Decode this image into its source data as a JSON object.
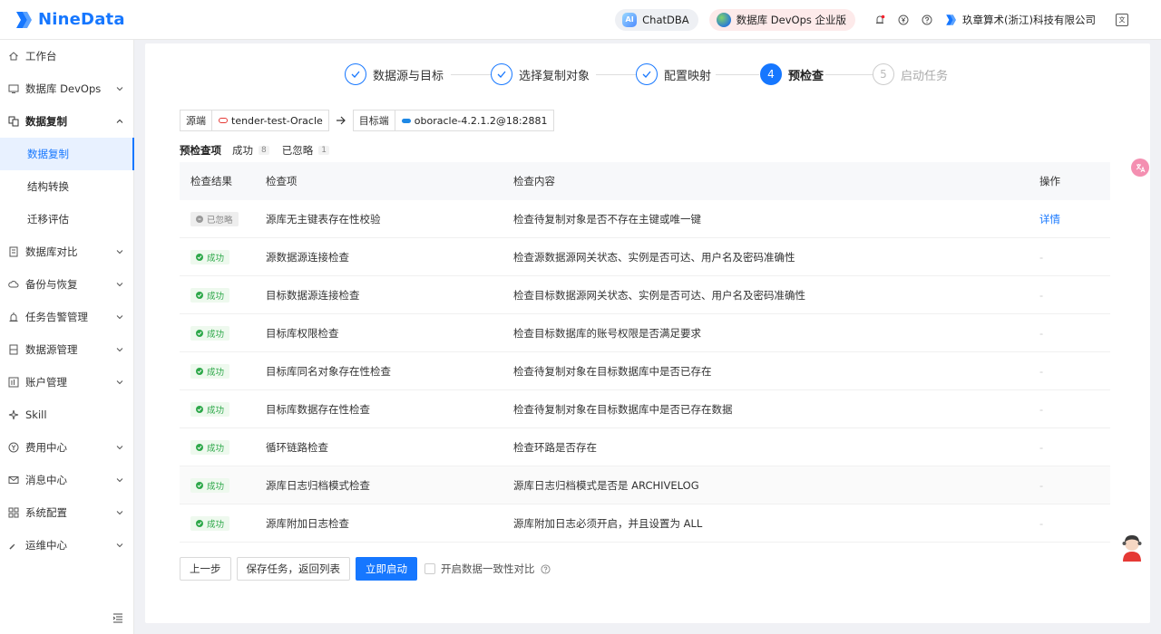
{
  "header": {
    "brand": "NineData",
    "chatdba_label": "ChatDBA",
    "chatdba_badge": "AI",
    "devops_label": "数据库 DevOps 企业版",
    "company": "玖章算术(浙江)科技有限公司",
    "icons": [
      "alert-icon",
      "yen-icon",
      "help-icon",
      "language-icon"
    ]
  },
  "sidebar": {
    "items": [
      {
        "label": "工作台",
        "icon": "home-icon"
      },
      {
        "label": "数据库 DevOps",
        "icon": "monitor-icon"
      },
      {
        "label": "数据复制",
        "icon": "replicate-icon"
      },
      {
        "label": "数据复制"
      },
      {
        "label": "结构转换"
      },
      {
        "label": "迁移评估"
      },
      {
        "label": "数据库对比",
        "icon": "compare-icon"
      },
      {
        "label": "备份与恢复",
        "icon": "cloud-icon"
      },
      {
        "label": "任务告警管理",
        "icon": "alarm-icon"
      },
      {
        "label": "数据源管理",
        "icon": "datasource-icon"
      },
      {
        "label": "账户管理",
        "icon": "account-icon"
      },
      {
        "label": "Skill",
        "icon": "sparkle-icon"
      },
      {
        "label": "费用中心",
        "icon": "yen-icon"
      },
      {
        "label": "消息中心",
        "icon": "mail-icon"
      },
      {
        "label": "系统配置",
        "icon": "grid-icon"
      },
      {
        "label": "运维中心",
        "icon": "wrench-icon"
      }
    ]
  },
  "steps": [
    {
      "num": "1",
      "label": "数据源与目标",
      "state": "done"
    },
    {
      "num": "2",
      "label": "选择复制对象",
      "state": "done"
    },
    {
      "num": "3",
      "label": "配置映射",
      "state": "done"
    },
    {
      "num": "4",
      "label": "预检查",
      "state": "active"
    },
    {
      "num": "5",
      "label": "启动任务",
      "state": "pending"
    }
  ],
  "endpoints": {
    "source_label": "源端",
    "source_value": "tender-test-Oracle",
    "target_label": "目标端",
    "target_value": "oboracle-4.2.1.2@18:2881"
  },
  "summary": {
    "title": "预检查项",
    "success_label": "成功",
    "success_count": "8",
    "ignored_label": "已忽略",
    "ignored_count": "1"
  },
  "table": {
    "columns": [
      "检查结果",
      "检查项",
      "检查内容",
      "操作"
    ],
    "rows": [
      {
        "status": "已忽略",
        "kind": "ignored",
        "item": "源库无主键表存在性校验",
        "content": "检查待复制对象是否不存在主键或唯一键",
        "action": "详情"
      },
      {
        "status": "成功",
        "kind": "ok",
        "item": "源数据源连接检查",
        "content": "检查源数据源网关状态、实例是否可达、用户名及密码准确性",
        "action": "-"
      },
      {
        "status": "成功",
        "kind": "ok",
        "item": "目标数据源连接检查",
        "content": "检查目标数据源网关状态、实例是否可达、用户名及密码准确性",
        "action": "-"
      },
      {
        "status": "成功",
        "kind": "ok",
        "item": "目标库权限检查",
        "content": "检查目标数据库的账号权限是否满足要求",
        "action": "-"
      },
      {
        "status": "成功",
        "kind": "ok",
        "item": "目标库同名对象存在性检查",
        "content": "检查待复制对象在目标数据库中是否已存在",
        "action": "-"
      },
      {
        "status": "成功",
        "kind": "ok",
        "item": "目标库数据存在性检查",
        "content": "检查待复制对象在目标数据库中是否已存在数据",
        "action": "-"
      },
      {
        "status": "成功",
        "kind": "ok",
        "item": "循环链路检查",
        "content": "检查环路是否存在",
        "action": "-"
      },
      {
        "status": "成功",
        "kind": "ok",
        "item": "源库日志归档模式检查",
        "content": "源库日志归档模式是否是 ARCHIVELOG",
        "action": "-"
      },
      {
        "status": "成功",
        "kind": "ok",
        "item": "源库附加日志检查",
        "content": "源库附加日志必须开启，并且设置为 ALL",
        "action": "-"
      }
    ]
  },
  "actions": {
    "prev": "上一步",
    "save": "保存任务，返回列表",
    "start": "立即启动",
    "compare_label": "开启数据一致性对比"
  },
  "colors": {
    "accent": "#1677ff",
    "success": "#2ea84a"
  }
}
